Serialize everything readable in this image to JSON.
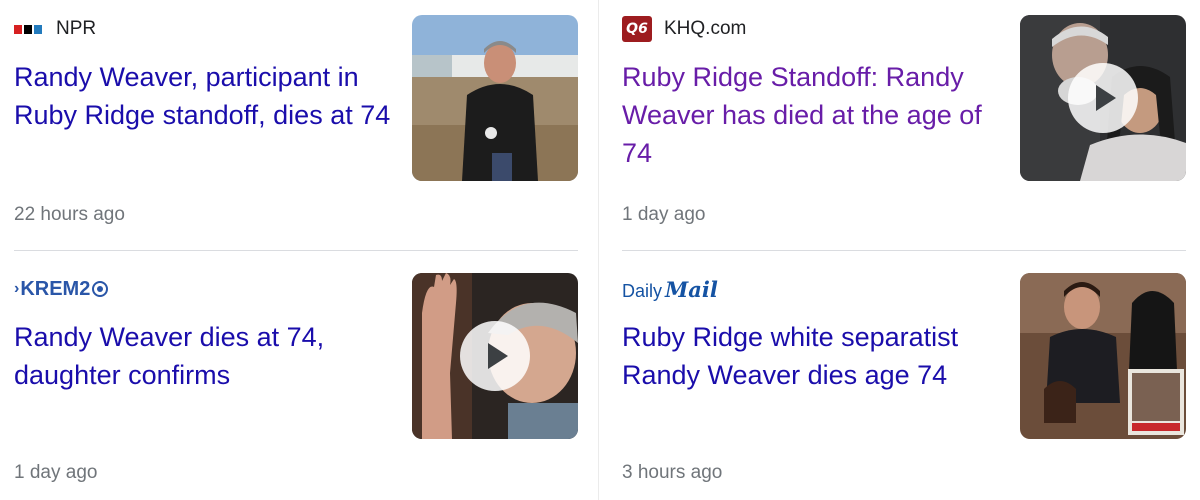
{
  "articles": [
    {
      "source": "NPR",
      "logo": "npr-logo",
      "title": "Randy Weaver, participant in Ruby Ridge standoff, dies at 74",
      "time": "22 hours ago",
      "has_video": false,
      "visited": false,
      "thumb_icon": "photo-man-leather-jacket"
    },
    {
      "source": "KHQ.com",
      "logo": "khq-logo",
      "logo_text": "Q6",
      "title": "Ruby Ridge Standoff: Randy Weaver has died at the age of 74",
      "time": "1 day ago",
      "has_video": true,
      "visited": true,
      "thumb_icon": "photo-couple"
    },
    {
      "source": "",
      "logo": "krem2-logo",
      "logo_text": "KREM2",
      "title": "Randy Weaver dies at 74, daughter confirms",
      "time": "1 day ago",
      "has_video": true,
      "visited": false,
      "thumb_icon": "photo-man-raising-hand"
    },
    {
      "source": "",
      "logo": "daily-mail-logo",
      "logo_text_1": "Daily",
      "logo_text_2": "Mail",
      "title": "Ruby Ridge white separatist Randy Weaver dies age 74",
      "time": "3 hours ago",
      "has_video": false,
      "visited": false,
      "thumb_icon": "photo-family-collage"
    }
  ],
  "colors": {
    "link": "#1a0dab",
    "visited_link": "#681da8",
    "meta_text": "#70757a",
    "source_text": "#202124",
    "divider": "#dadce0",
    "khq_brand": "#9d1c1f",
    "krem_brand": "#2a56a8",
    "daily_mail_brand": "#1553a3"
  }
}
